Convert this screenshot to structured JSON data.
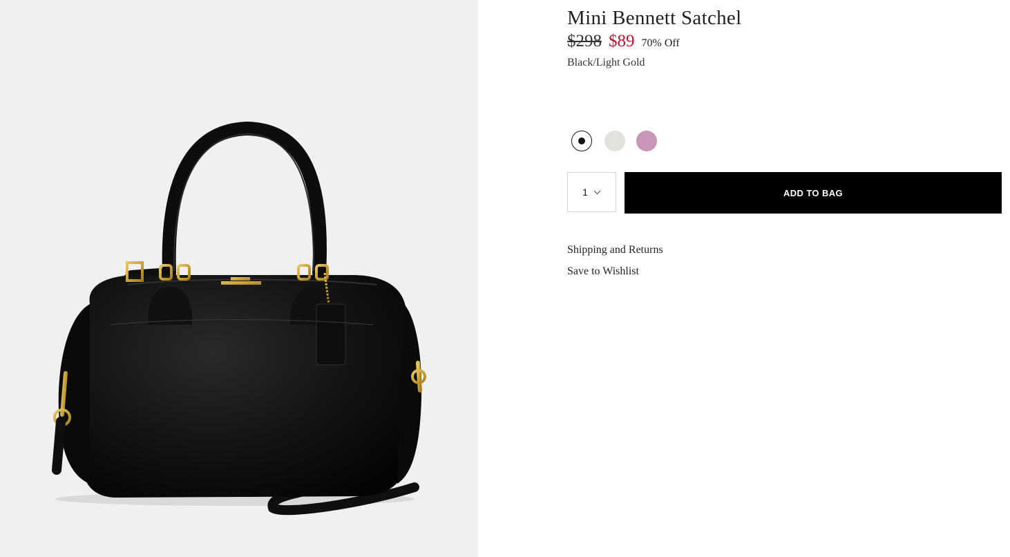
{
  "product": {
    "title": "Mini Bennett Satchel",
    "price_original": "$298",
    "price_sale": "$89",
    "discount": "70% Off",
    "color_name": "Black/Light Gold"
  },
  "swatches": [
    {
      "name": "Black/Light Gold",
      "color": "#111111",
      "selected": true
    },
    {
      "name": "light-grey",
      "color": "#e2e2dd",
      "selected": false
    },
    {
      "name": "mauve",
      "color": "#c996b8",
      "selected": false
    }
  ],
  "quantity": {
    "value": "1",
    "icon": "chevron-down-icon"
  },
  "actions": {
    "add_to_bag": "ADD TO BAG",
    "shipping_returns": "Shipping and Returns",
    "save_wishlist": "Save to Wishlist"
  },
  "colors": {
    "sale_price": "#c8102e",
    "button_bg": "#000000",
    "image_bg": "#f0f0f0"
  }
}
